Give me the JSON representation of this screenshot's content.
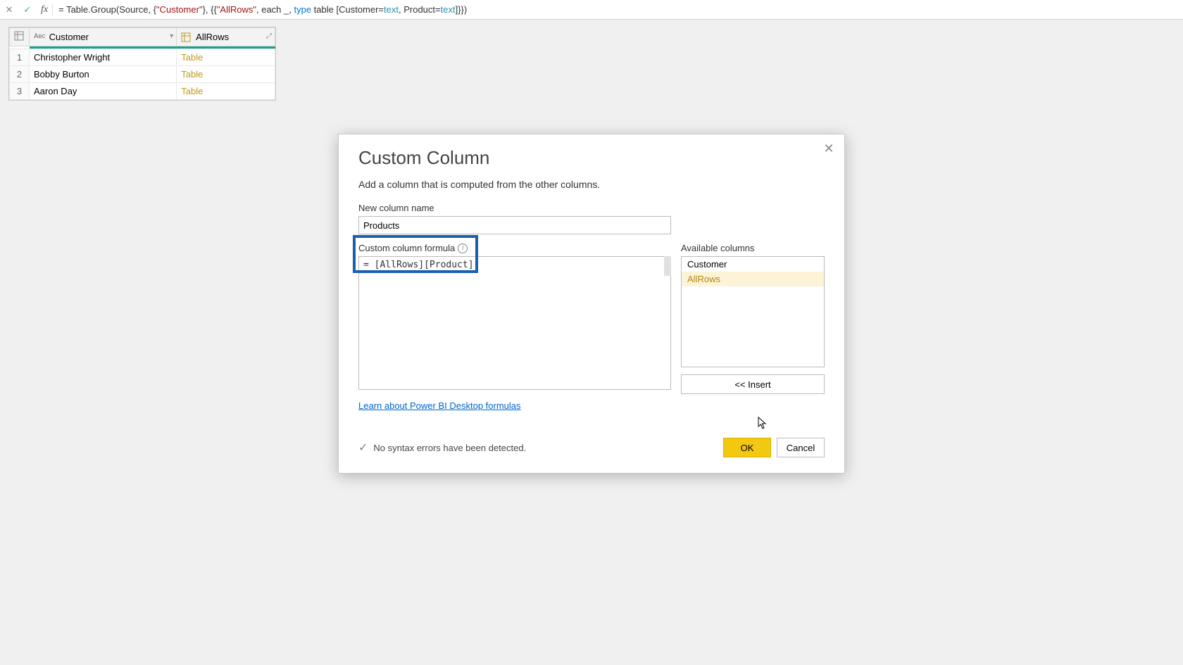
{
  "formula_bar": {
    "prefix": "= Table.Group(Source, {",
    "str_customer": "\"Customer\"",
    "mid1": "}, {{",
    "str_allrows": "\"AllRows\"",
    "mid2": ", each _, ",
    "kw_type": "type",
    "mid3": " table [Customer=",
    "typ_text1": "text",
    "mid4": ", Product=",
    "typ_text2": "text",
    "suffix": "]}})",
    "fx_label": "fx"
  },
  "preview": {
    "columns": [
      {
        "name": "Customer",
        "icon_code": "ABC"
      },
      {
        "name": "AllRows",
        "icon_code": "TBL"
      }
    ],
    "rows": [
      {
        "n": "1",
        "customer": "Christopher Wright",
        "allrows": "Table"
      },
      {
        "n": "2",
        "customer": "Bobby Burton",
        "allrows": "Table"
      },
      {
        "n": "3",
        "customer": "Aaron Day",
        "allrows": "Table"
      }
    ]
  },
  "dialog": {
    "title": "Custom Column",
    "description": "Add a column that is computed from the other columns.",
    "new_col_label": "New column name",
    "new_col_value": "Products",
    "formula_label": "Custom column formula",
    "formula_value": "= [AllRows][Product]",
    "available_label": "Available columns",
    "available_columns": [
      {
        "name": "Customer",
        "selected": false
      },
      {
        "name": "AllRows",
        "selected": true
      }
    ],
    "insert_label": "<< Insert",
    "learn_link": "Learn about Power BI Desktop formulas",
    "status_text": "No syntax errors have been detected.",
    "ok_label": "OK",
    "cancel_label": "Cancel",
    "close_glyph": "✕",
    "check_glyph": "✓",
    "info_glyph": "i"
  }
}
